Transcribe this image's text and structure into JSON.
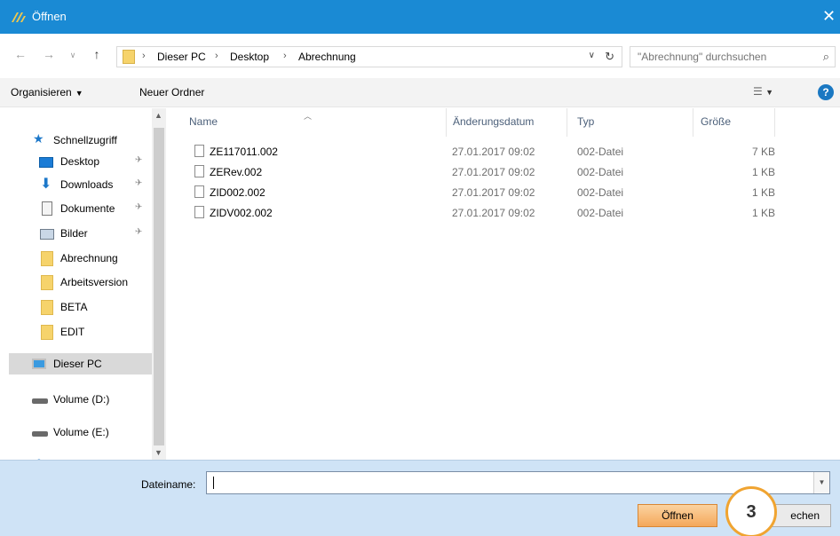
{
  "window": {
    "title": "Öffnen",
    "close_glyph": "✕"
  },
  "address": {
    "crumbs": [
      "Dieser PC",
      "Desktop",
      "Abrechnung"
    ],
    "search_placeholder": "\"Abrechnung\" durchsuchen"
  },
  "toolbar": {
    "organize_label": "Organisieren",
    "new_folder_label": "Neuer Ordner",
    "help_label": "?"
  },
  "nav": {
    "items": [
      {
        "label": "Schnellzugriff",
        "icon": "star-icon"
      },
      {
        "label": "Desktop",
        "icon": "desktop-icon",
        "pinned": true
      },
      {
        "label": "Downloads",
        "icon": "download-icon",
        "pinned": true
      },
      {
        "label": "Dokumente",
        "icon": "documents-icon",
        "pinned": true
      },
      {
        "label": "Bilder",
        "icon": "pictures-icon",
        "pinned": true
      },
      {
        "label": "Abrechnung",
        "icon": "folder-icon"
      },
      {
        "label": "Arbeitsversion",
        "icon": "folder-icon"
      },
      {
        "label": "BETA",
        "icon": "folder-icon"
      },
      {
        "label": "EDIT",
        "icon": "folder-icon"
      },
      {
        "label": "Dieser PC",
        "icon": "pc-icon",
        "selected": true
      },
      {
        "label": "Volume (D:)",
        "icon": "drive-icon"
      },
      {
        "label": "Volume (E:)",
        "icon": "drive-icon"
      }
    ]
  },
  "files": {
    "columns": [
      "Name",
      "Änderungsdatum",
      "Typ",
      "Größe"
    ],
    "rows": [
      {
        "name": "ZE117011.002",
        "date": "27.01.2017 09:02",
        "type": "002-Datei",
        "size": "7 KB"
      },
      {
        "name": "ZERev.002",
        "date": "27.01.2017 09:02",
        "type": "002-Datei",
        "size": "1 KB"
      },
      {
        "name": "ZID002.002",
        "date": "27.01.2017 09:02",
        "type": "002-Datei",
        "size": "1 KB"
      },
      {
        "name": "ZIDV002.002",
        "date": "27.01.2017 09:02",
        "type": "002-Datei",
        "size": "1 KB"
      }
    ]
  },
  "footer": {
    "filename_label": "Dateiname:",
    "filename_value": "",
    "open_label": "Öffnen",
    "cancel_label": "echen"
  },
  "callout": {
    "number": "3"
  },
  "colors": {
    "titlebar": "#1a8ad4",
    "bottom_panel": "#cfe3f6",
    "open_button": "#f4a85b",
    "callout_border": "#f0a431"
  }
}
